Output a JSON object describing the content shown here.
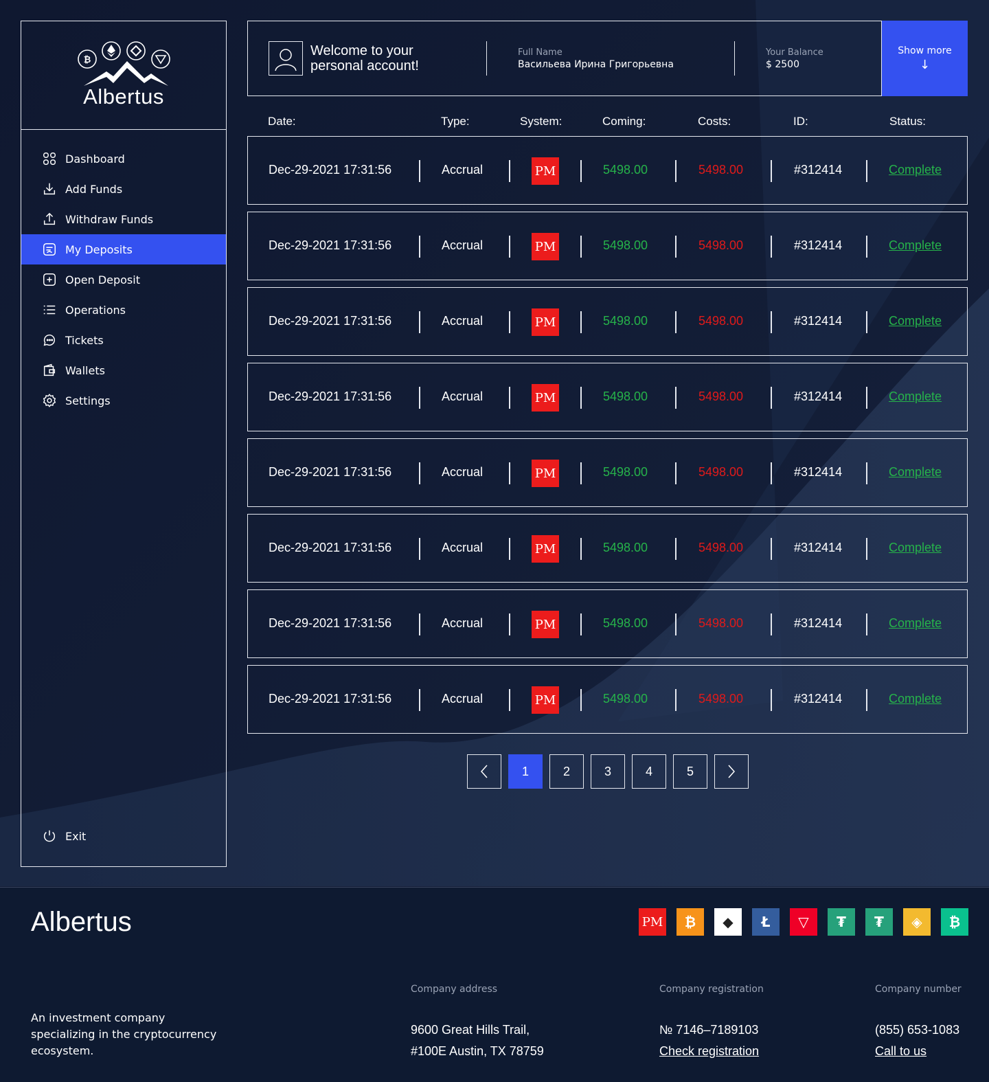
{
  "brand": {
    "name": "Albertus"
  },
  "sidebar": {
    "items": [
      {
        "label": "Dashboard",
        "icon": "grid-icon"
      },
      {
        "label": "Add Funds",
        "icon": "download-icon"
      },
      {
        "label": "Withdraw Funds",
        "icon": "upload-icon"
      },
      {
        "label": "My Deposits",
        "icon": "deposit-icon",
        "active": true
      },
      {
        "label": "Open Deposit",
        "icon": "plus-square-icon"
      },
      {
        "label": "Operations",
        "icon": "list-icon"
      },
      {
        "label": "Tickets",
        "icon": "chat-icon"
      },
      {
        "label": "Wallets",
        "icon": "wallet-icon"
      },
      {
        "label": "Settings",
        "icon": "gear-icon"
      }
    ],
    "exit_label": "Exit"
  },
  "header": {
    "welcome": "Welcome to your personal account!",
    "full_name_label": "Full Name",
    "full_name": "Васильева Ирина Григорьевна",
    "balance_label": "Your Balance",
    "balance": "$ 2500",
    "show_more": "Show more",
    "show_more_arrow": "↓"
  },
  "table": {
    "headers": [
      "Date:",
      "Type:",
      "System:",
      "Coming:",
      "Costs:",
      "ID:",
      "Status:"
    ],
    "rows": [
      {
        "date": "Dec-29-2021 17:31:56",
        "type": "Accrual",
        "system": "PM",
        "coming": "5498.00",
        "costs": "5498.00",
        "id": "#312414",
        "status": "Complete"
      },
      {
        "date": "Dec-29-2021 17:31:56",
        "type": "Accrual",
        "system": "PM",
        "coming": "5498.00",
        "costs": "5498.00",
        "id": "#312414",
        "status": "Complete"
      },
      {
        "date": "Dec-29-2021 17:31:56",
        "type": "Accrual",
        "system": "PM",
        "coming": "5498.00",
        "costs": "5498.00",
        "id": "#312414",
        "status": "Complete"
      },
      {
        "date": "Dec-29-2021 17:31:56",
        "type": "Accrual",
        "system": "PM",
        "coming": "5498.00",
        "costs": "5498.00",
        "id": "#312414",
        "status": "Complete"
      },
      {
        "date": "Dec-29-2021 17:31:56",
        "type": "Accrual",
        "system": "PM",
        "coming": "5498.00",
        "costs": "5498.00",
        "id": "#312414",
        "status": "Complete"
      },
      {
        "date": "Dec-29-2021 17:31:56",
        "type": "Accrual",
        "system": "PM",
        "coming": "5498.00",
        "costs": "5498.00",
        "id": "#312414",
        "status": "Complete"
      },
      {
        "date": "Dec-29-2021 17:31:56",
        "type": "Accrual",
        "system": "PM",
        "coming": "5498.00",
        "costs": "5498.00",
        "id": "#312414",
        "status": "Complete"
      },
      {
        "date": "Dec-29-2021 17:31:56",
        "type": "Accrual",
        "system": "PM",
        "coming": "5498.00",
        "costs": "5498.00",
        "id": "#312414",
        "status": "Complete"
      }
    ]
  },
  "pagination": {
    "pages": [
      "1",
      "2",
      "3",
      "4",
      "5"
    ],
    "current": "1"
  },
  "footer": {
    "brand": "Albertus",
    "description": "An investment company specializing in the cryptocurrency ecosystem.",
    "payment_icons": [
      {
        "name": "pm-icon",
        "glyph": "PM",
        "bg": "#ec1c1c"
      },
      {
        "name": "bitcoin-icon",
        "glyph": "₿",
        "bg": "#f7931a"
      },
      {
        "name": "ethereum-icon",
        "glyph": "◆",
        "bg": "#ffffff"
      },
      {
        "name": "litecoin-icon",
        "glyph": "Ł",
        "bg": "#345d9d"
      },
      {
        "name": "tron-icon",
        "glyph": "▽",
        "bg": "#ef0027"
      },
      {
        "name": "tether-trc20-icon",
        "glyph": "₮",
        "bg": "#26a17b"
      },
      {
        "name": "tether-erc20-icon",
        "glyph": "₮",
        "bg": "#26a17b"
      },
      {
        "name": "binance-icon",
        "glyph": "◈",
        "bg": "#f3ba2f"
      },
      {
        "name": "bitcoin-cash-icon",
        "glyph": "₿",
        "bg": "#0ac18e"
      }
    ],
    "address_label": "Company address",
    "address_line1": "9600 Great Hills Trail,",
    "address_line2": "#100E Austin, TX 78759",
    "registration_label": "Company registration",
    "registration_number": "№ 7146–7189103",
    "registration_link": "Check registration",
    "number_label": "Company number",
    "phone": "(855) 653-1083",
    "call_link": "Call to us"
  },
  "colors": {
    "accent": "#3451f0",
    "positive": "#26b34a",
    "negative": "#e01a1a",
    "background": "#101a30"
  }
}
